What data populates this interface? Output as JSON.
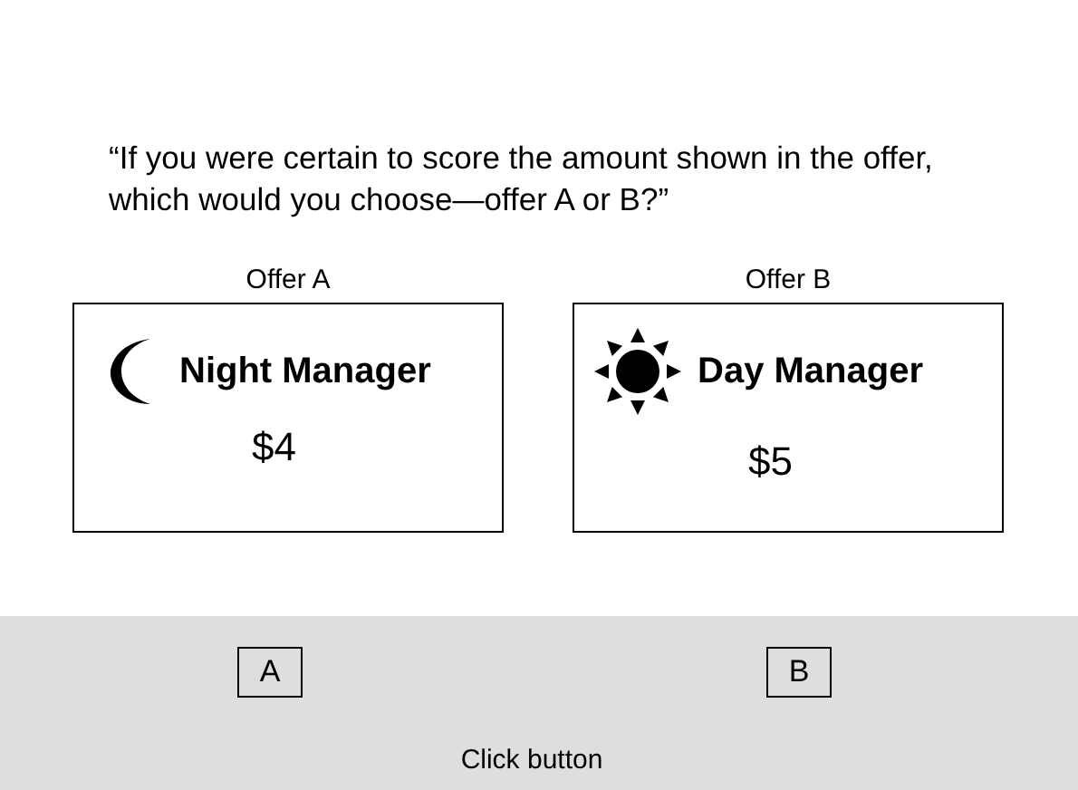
{
  "question": "“If you were certain to score the amount shown in the offer, which would you choose—offer A or B?”",
  "offers": [
    {
      "label": "Offer A",
      "title": "Night Manager",
      "amount": "$4"
    },
    {
      "label": "Offer B",
      "title": "Day Manager",
      "amount": "$5"
    }
  ],
  "buttons": [
    "A",
    "B"
  ],
  "instruction": "Click button"
}
